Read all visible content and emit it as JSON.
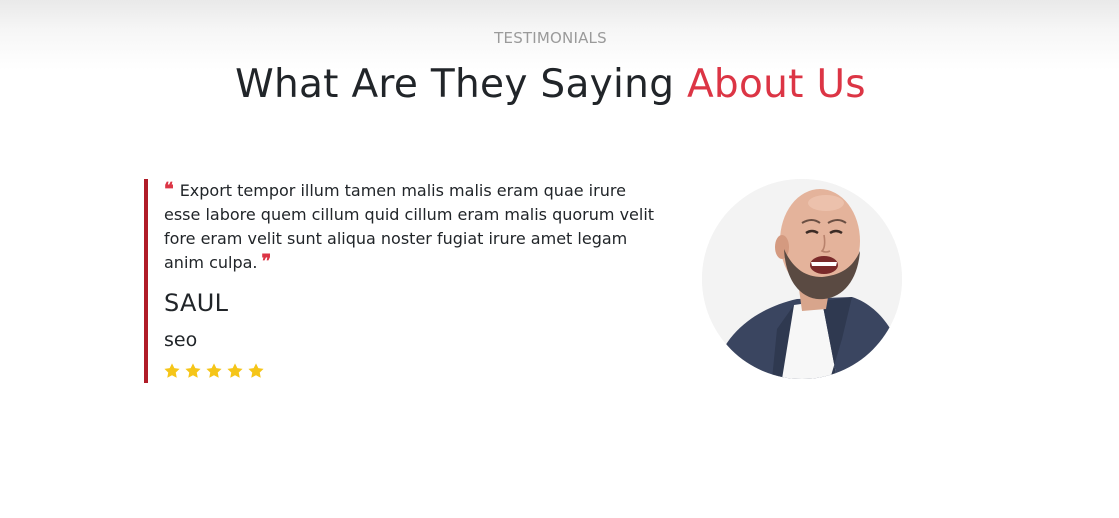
{
  "section": {
    "eyebrow": "TESTIMONIALS",
    "heading_main": "What Are They Saying",
    "heading_accent": "About Us"
  },
  "testimonial": {
    "quote": "Export tempor illum tamen malis malis eram quae irure esse labore quem cillum quid cillum eram malis quorum velit fore eram velit sunt aliqua noster fugiat irure amet legam anim culpa.",
    "author_name": "SAUL",
    "author_role": "seo",
    "rating": 5
  },
  "colors": {
    "accent": "#dc3545",
    "border": "#b01c28",
    "star": "#f5c518",
    "text": "#212529",
    "muted": "#9a9a9a"
  },
  "icons": {
    "quote_open": "quote-left-icon",
    "quote_close": "quote-right-icon",
    "star": "star-icon"
  }
}
